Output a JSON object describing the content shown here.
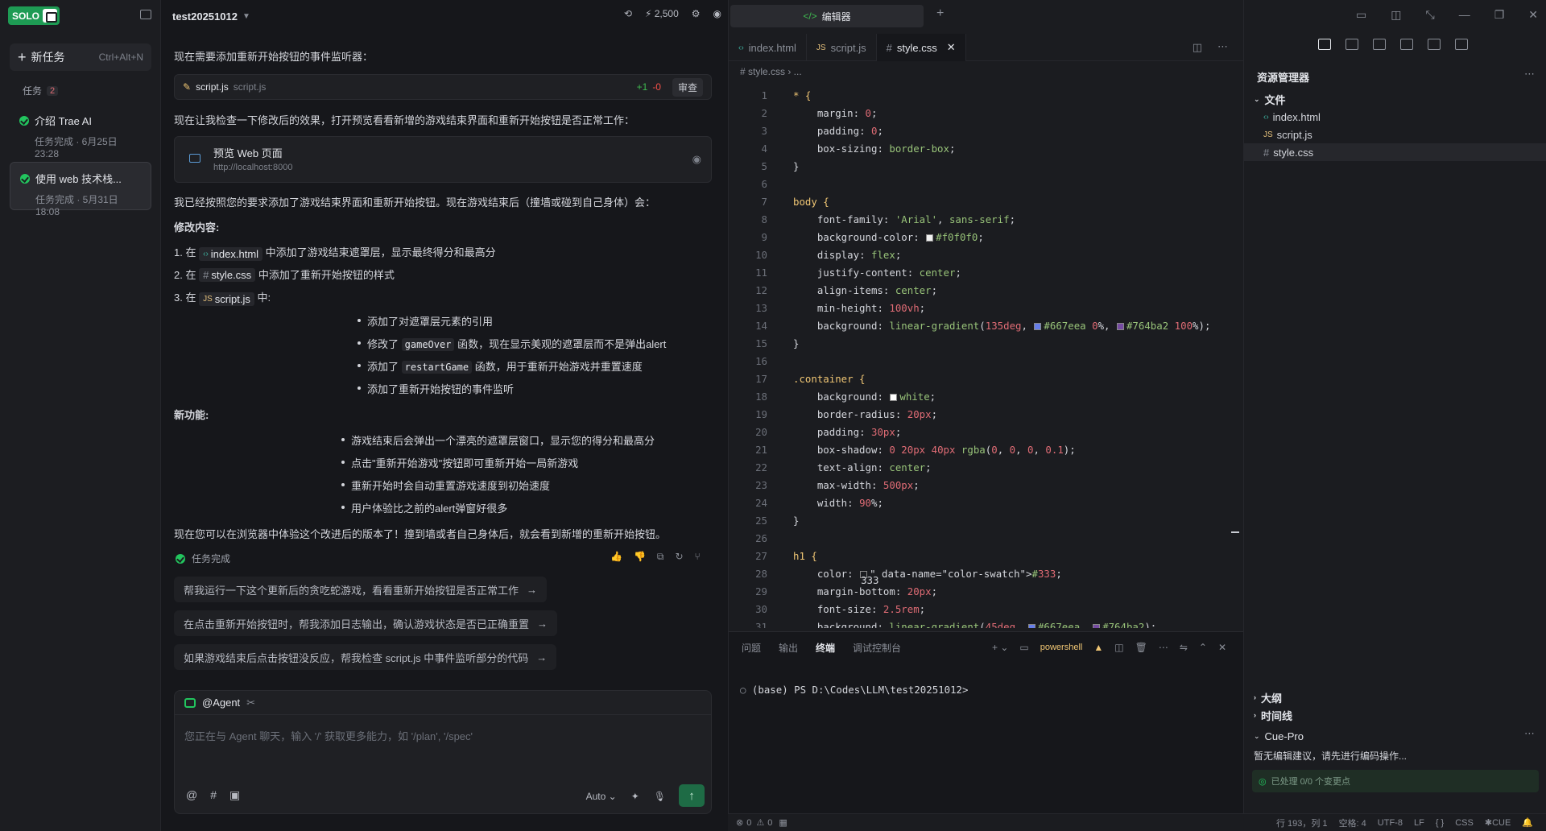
{
  "sidebar": {
    "logo_text": "SOLO",
    "new_task_label": "新任务",
    "new_task_shortcut": "Ctrl+Alt+N",
    "task_section_label": "任务",
    "task_count": "2",
    "tasks": [
      {
        "title": "介绍 Trae AI",
        "status": "任务完成 · 6月25日 23:28"
      },
      {
        "title": "使用 web 技术栈...",
        "status": "任务完成 · 5月31日 18:08"
      }
    ]
  },
  "chat": {
    "project_name": "test20251012",
    "credits": "2,500",
    "intro_text": "现在需要添加重新开始按钮的事件监听器：",
    "file_card": {
      "name": "script.js",
      "path": "script.js",
      "added": "+1",
      "removed": "-0",
      "review_label": "审查"
    },
    "check_text": "现在让我检查一下修改后的效果，打开预览看看新增的游戏结束界面和重新开始按钮是否正常工作：",
    "preview": {
      "title": "预览 Web 页面",
      "url": "http://localhost:8000"
    },
    "summary": "我已经按照您的要求添加了游戏结束界面和重新开始按钮。现在游戏结束后（撞墙或碰到自己身体）会：",
    "changes_heading": "修改内容:",
    "change_items": [
      {
        "num": "1.",
        "pre": "在",
        "chip": "index.html",
        "post": "中添加了游戏结束遮罩层，显示最终得分和最高分"
      },
      {
        "num": "2.",
        "pre": "在",
        "chip": "style.css",
        "post": "中添加了重新开始按钮的样式"
      },
      {
        "num": "3.",
        "pre": "在",
        "chip": "script.js",
        "post": "中:"
      }
    ],
    "sub_items": [
      {
        "pre": "添加了对遮罩层元素的引用",
        "code": "",
        "post": ""
      },
      {
        "pre": "修改了",
        "code": "gameOver",
        "post": "函数，现在显示美观的遮罩层而不是弹出alert"
      },
      {
        "pre": "添加了",
        "code": "restartGame",
        "post": "函数，用于重新开始游戏并重置速度"
      },
      {
        "pre": "添加了重新开始按钮的事件监听",
        "code": "",
        "post": ""
      }
    ],
    "features_heading": "新功能:",
    "features": [
      "游戏结束后会弹出一个漂亮的遮罩层窗口，显示您的得分和最高分",
      "点击\"重新开始游戏\"按钮即可重新开始一局新游戏",
      "重新开始时会自动重置游戏速度到初始速度",
      "用户体验比之前的alert弹窗好很多"
    ],
    "closing": "现在您可以在浏览器中体验这个改进后的版本了！撞到墙或者自己身体后，就会看到新增的重新开始按钮。",
    "done_label": "任务完成",
    "suggestions": [
      "帮我运行一下这个更新后的贪吃蛇游戏，看看重新开始按钮是否正常工作",
      "在点击重新开始按钮时，帮我添加日志输出，确认游戏状态是否已正确重置",
      "如果游戏结束后点击按钮没反应，帮我检查 script.js 中事件监听部分的代码"
    ],
    "agent_label": "@Agent",
    "input_placeholder": "您正在与 Agent 聊天，输入 '/' 获取更多能力，如 '/plan', '/spec'",
    "mode_label": "Auto"
  },
  "editor": {
    "top_tab_label": "编辑器",
    "tabs": [
      {
        "label": "index.html",
        "prefix": "‹›"
      },
      {
        "label": "script.js",
        "prefix": "JS"
      },
      {
        "label": "style.css",
        "prefix": "#"
      }
    ],
    "breadcrumb": "# style.css  ›  ...",
    "code_lines": [
      "* {",
      "    margin: 0;",
      "    padding: 0;",
      "    box-sizing: border-box;",
      "}",
      "",
      "body {",
      "    font-family: 'Arial', sans-serif;",
      "    background-color: #f0f0f0;",
      "    display: flex;",
      "    justify-content: center;",
      "    align-items: center;",
      "    min-height: 100vh;",
      "    background: linear-gradient(135deg, #667eea 0%, #764ba2 100%);",
      "}",
      "",
      ".container {",
      "    background: white;",
      "    border-radius: 20px;",
      "    padding: 30px;",
      "    box-shadow: 0 20px 40px rgba(0, 0, 0, 0.1);",
      "    text-align: center;",
      "    max-width: 500px;",
      "    width: 90%;",
      "}",
      "",
      "h1 {",
      "    color: #333;",
      "    margin-bottom: 20px;",
      "    font-size: 2.5rem;",
      "    background: linear-gradient(45deg, #667eea, #764ba2);"
    ],
    "terminal": {
      "tabs": [
        "问题",
        "输出",
        "终端",
        "调试控制台"
      ],
      "shell": "powershell",
      "prompt": "(base) PS D:\\Codes\\LLM\\test20251012>"
    }
  },
  "explorer": {
    "title": "资源管理器",
    "folder": "文件",
    "files": [
      {
        "name": "index.html",
        "prefix": "‹›"
      },
      {
        "name": "script.js",
        "prefix": "JS"
      },
      {
        "name": "style.css",
        "prefix": "#"
      }
    ],
    "outline": "大纲",
    "timeline": "时间线",
    "cue_title": "Cue-Pro",
    "cue_msg": "暂无编辑建议，请先进行编码操作...",
    "cue_status": "已处理 0/0 个变更点"
  },
  "statusbar": {
    "errors": "0",
    "warnings": "0",
    "position": "行 193，列 1",
    "spaces": "空格: 4",
    "encoding": "UTF-8",
    "eol": "LF",
    "braces": "{ }",
    "lang": "CSS",
    "cue": "CUE"
  },
  "colors": {
    "accent": "#22c55e",
    "brand": "#1e9b54",
    "swatch_bg": "#f0f0f0",
    "swatch_a": "#667eea",
    "swatch_b": "#764ba2"
  }
}
